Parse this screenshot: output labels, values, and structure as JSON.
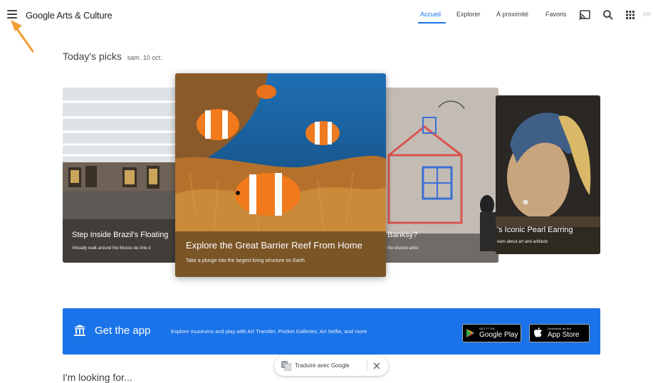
{
  "header": {
    "logo": "Google Arts & Culture",
    "nav": [
      "Accueil",
      "Explorer",
      "À proximité",
      "Favoris"
    ],
    "active_nav": "Accueil",
    "icons": [
      "cast-icon",
      "search-icon",
      "apps-grid-icon"
    ],
    "avatar_text": "pet"
  },
  "picks": {
    "title": "Today's picks",
    "date": "sam. 10 oct.",
    "cards": [
      {
        "title": "Step Inside Brazil's Floating",
        "subtitle": "Virtually walk around the Museu de Arte d"
      },
      {
        "title": "Explore the Great Barrier Reef From Home",
        "subtitle": "Take a plunge into the largest living structure on Earth"
      },
      {
        "title": "Banksy?",
        "subtitle": "the elusive artist"
      },
      {
        "title": "'s Iconic Pearl Earring",
        "subtitle": "eam about art and artifacts"
      }
    ]
  },
  "app_banner": {
    "title": "Get the app",
    "description": "Explore museums and play with Art Transfer, Pocket Galleries, Art Selfie, and more",
    "google_play_small": "GET IT ON",
    "google_play": "Google Play",
    "app_store_small": "Download on the",
    "app_store": "App Store"
  },
  "looking_for": "I'm looking for...",
  "translate": {
    "label": "Traduire avec Google"
  },
  "colors": {
    "accent": "#1a73e8",
    "banner": "#1a73e8",
    "arrow": "#f39c35"
  }
}
